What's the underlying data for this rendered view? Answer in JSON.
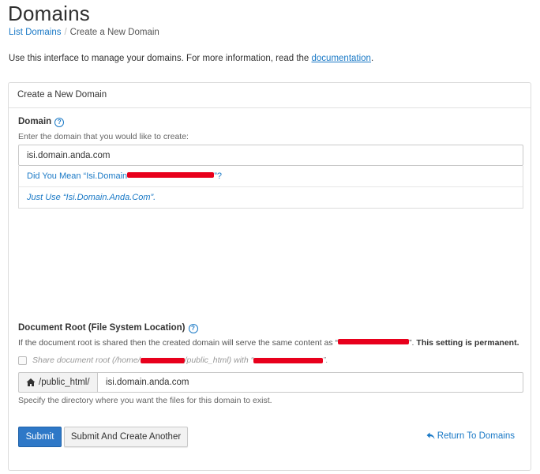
{
  "page": {
    "title": "Domains"
  },
  "breadcrumb": {
    "parent": "List Domains",
    "separator": "/",
    "current": "Create a New Domain"
  },
  "intro": {
    "text": "Use this interface to manage your domains. For more information, read the ",
    "link": "documentation",
    "end": "."
  },
  "panel": {
    "heading": "Create a New Domain"
  },
  "domain": {
    "label": "Domain",
    "hint": "Enter the domain that you would like to create:",
    "value": "isi.domain.anda.com",
    "suggestion_prefix": "Did You Mean “Isi.Domain",
    "suggestion_suffix": "”?",
    "just_use": "Just Use “Isi.Domain.Anda.Com”."
  },
  "docroot": {
    "label": "Document Root (File System Location)",
    "hint_prefix": "If the document root is shared then the created domain will serve the same content as “",
    "hint_suffix": "”.",
    "permanent": "This setting is permanent.",
    "share_prefix": "Share document root (/home/",
    "share_mid": "/public_html) with “",
    "share_suffix": "”.",
    "addon": "/public_html/",
    "value": "isi.domain.anda.com",
    "help": "Specify the directory where you want the files for this domain to exist."
  },
  "buttons": {
    "submit": "Submit",
    "submit_another": "Submit And Create Another",
    "return": "Return To Domains"
  },
  "colors": {
    "link": "#1a79c6",
    "primary": "#2e78c7",
    "redaction": "#e8001c"
  },
  "icons": {
    "help": "question-circle-icon",
    "home": "home-icon",
    "return": "reply-arrow-icon"
  }
}
